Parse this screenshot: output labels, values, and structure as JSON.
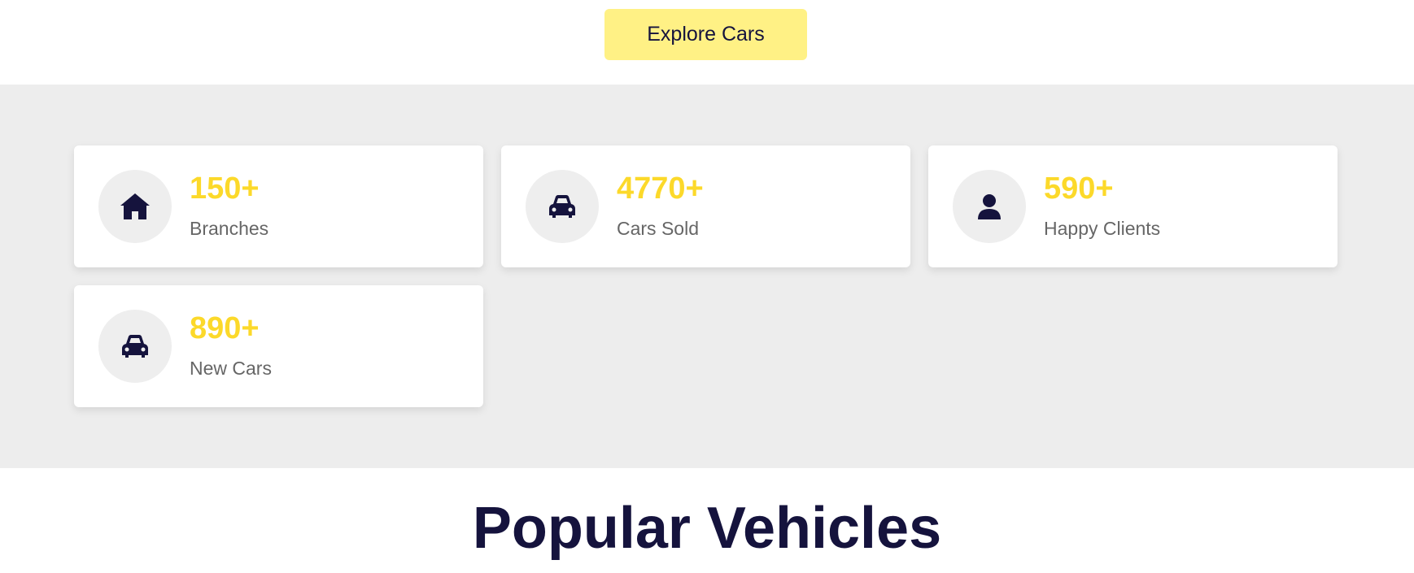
{
  "header": {
    "explore_button_label": "Explore Cars"
  },
  "stats": [
    {
      "icon": "house-icon",
      "value": "150+",
      "label": "Branches"
    },
    {
      "icon": "car-icon",
      "value": "4770+",
      "label": "Cars Sold"
    },
    {
      "icon": "user-icon",
      "value": "590+",
      "label": "Happy Clients"
    },
    {
      "icon": "car-icon",
      "value": "890+",
      "label": "New Cars"
    }
  ],
  "section": {
    "title_part1": "Popular ",
    "title_part2": "Vehicles"
  },
  "colors": {
    "accent_yellow": "#fcd92a",
    "button_yellow": "#fff185",
    "navy": "#15133d",
    "panel_grey": "#ededed"
  }
}
